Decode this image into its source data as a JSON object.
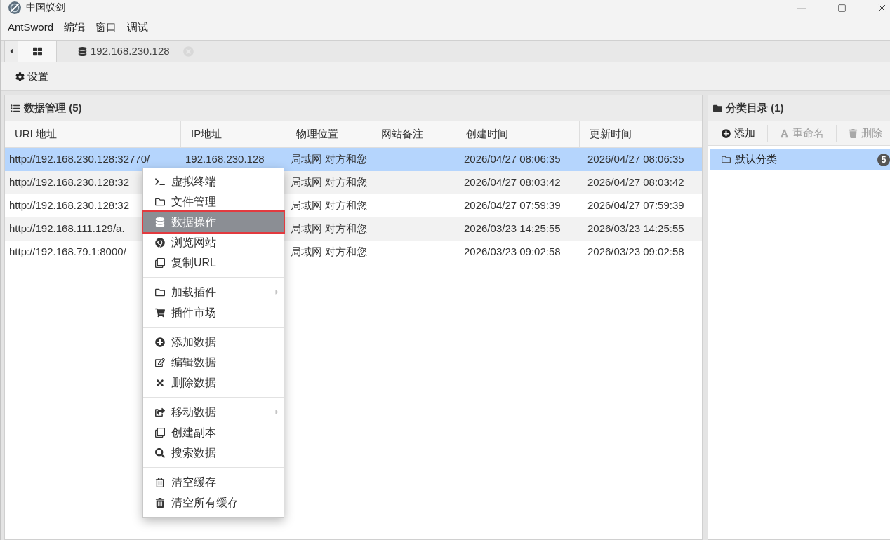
{
  "window": {
    "title": "中国蚁剑"
  },
  "menu_bar": [
    "AntSword",
    "编辑",
    "窗口",
    "调试"
  ],
  "tabs": [
    {
      "selected": true
    },
    {
      "label": "192.168.230.128",
      "selected": false
    }
  ],
  "toolbar": [
    "设置"
  ],
  "data_panel": {
    "title": "数据管理 (5)",
    "columns": [
      "URL地址",
      "IP地址",
      "物理位置",
      "网站备注",
      "创建时间",
      "更新时间"
    ],
    "rows": [
      {
        "url": "http://192.168.230.128:32770/",
        "ip": "192.168.230.128",
        "location": "局域网 对方和您",
        "created": "2026/04/27 08:06:35",
        "updated": "2026/04/27 08:06:35",
        "selected": true
      },
      {
        "url": "http://192.168.230.128:32",
        "location": "局域网 对方和您",
        "created": "2026/04/27 08:03:42",
        "updated": "2026/04/27 08:03:42",
        "selected": false
      },
      {
        "url": "http://192.168.230.128:32",
        "location": "局域网 对方和您",
        "created": "2026/04/27 07:59:39",
        "updated": "2026/04/27 07:59:39",
        "selected": false
      },
      {
        "url": "http://192.168.111.129/a.",
        "location": "局域网 对方和您",
        "created": "2026/03/23 14:25:55",
        "updated": "2026/03/23 14:25:55",
        "selected": false
      },
      {
        "url": "http://192.168.79.1:8000/",
        "location": "局域网 对方和您",
        "created": "2026/03/23 09:02:58",
        "updated": "2026/03/23 09:02:58",
        "selected": false
      }
    ]
  },
  "category_panel": {
    "title": "分类目录 (1)",
    "toolbar": [
      {
        "label": "添加",
        "disabled": false
      },
      {
        "label": "重命名",
        "disabled": true
      },
      {
        "label": "删除",
        "disabled": true
      }
    ],
    "items": [
      {
        "label": "默认分类",
        "badge": "5",
        "selected": true
      }
    ]
  },
  "context_menu": {
    "groups": [
      [
        {
          "label": "虚拟终端",
          "selected": false,
          "submenu": false
        },
        {
          "label": "文件管理",
          "selected": false,
          "submenu": false
        },
        {
          "label": "数据操作",
          "selected": true,
          "submenu": false
        },
        {
          "label": "浏览网站",
          "selected": false,
          "submenu": false
        },
        {
          "label": "复制URL",
          "selected": false,
          "submenu": false
        }
      ],
      [
        {
          "label": "加载插件",
          "selected": false,
          "submenu": true
        },
        {
          "label": "插件市场",
          "selected": false,
          "submenu": false
        }
      ],
      [
        {
          "label": "添加数据",
          "selected": false,
          "submenu": false
        },
        {
          "label": "编辑数据",
          "selected": false,
          "submenu": false
        },
        {
          "label": "删除数据",
          "selected": false,
          "submenu": false
        }
      ],
      [
        {
          "label": "移动数据",
          "selected": false,
          "submenu": true
        },
        {
          "label": "创建副本",
          "selected": false,
          "submenu": false
        },
        {
          "label": "搜索数据",
          "selected": false,
          "submenu": false
        }
      ],
      [
        {
          "label": "清空缓存",
          "selected": false,
          "submenu": false
        },
        {
          "label": "清空所有缓存",
          "selected": false,
          "submenu": false
        }
      ]
    ]
  }
}
